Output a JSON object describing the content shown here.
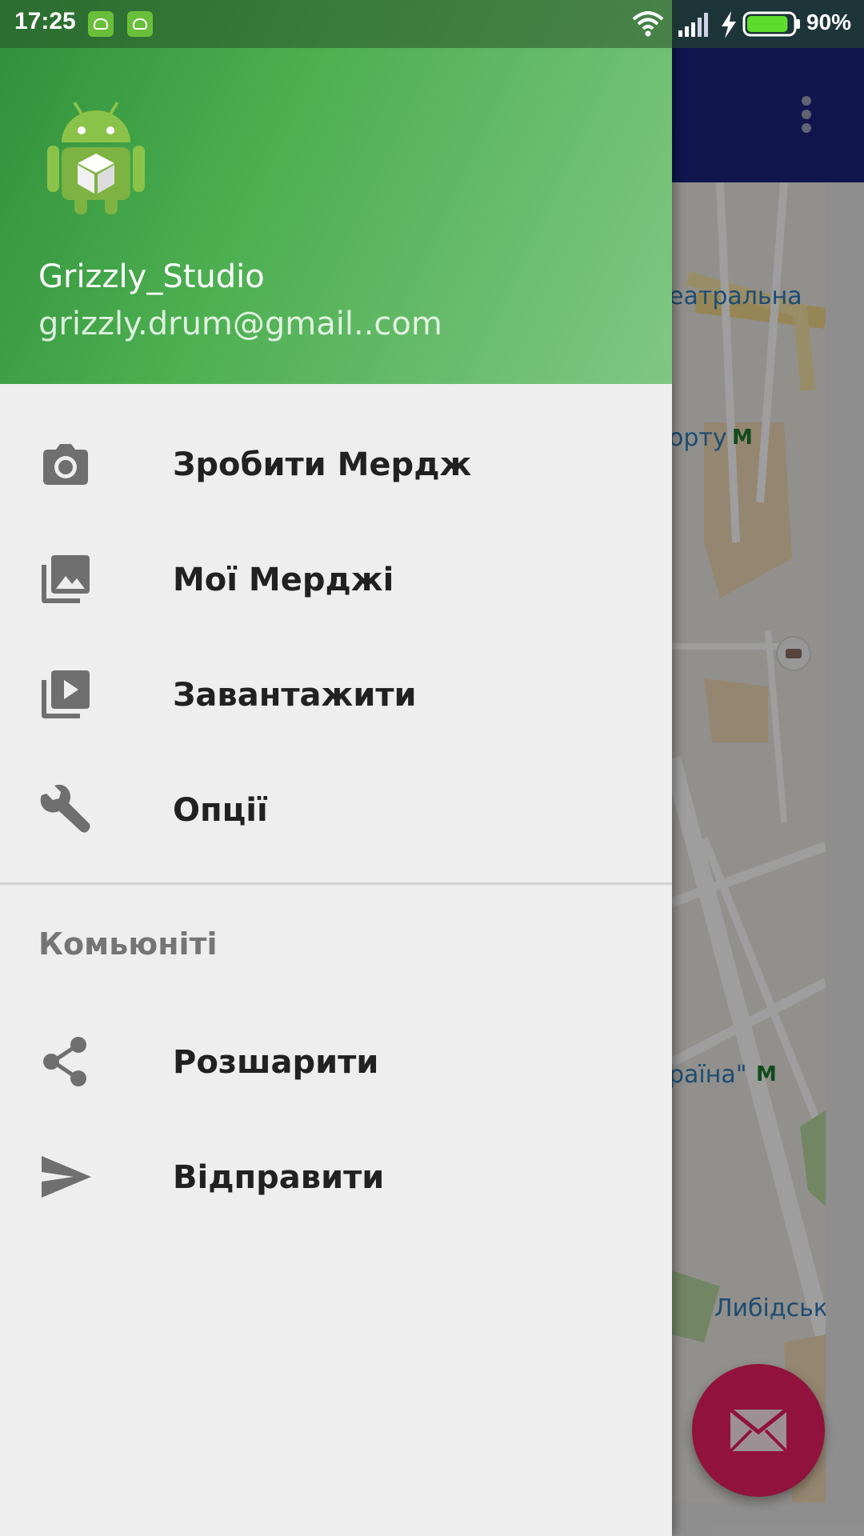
{
  "status_bar": {
    "time": "17:25",
    "battery_percent": "90%",
    "battery_level": 0.9,
    "icons": [
      "android-notification-icon",
      "android-notification-icon",
      "wifi-icon",
      "signal-icon",
      "charging-icon",
      "battery-icon"
    ]
  },
  "drawer": {
    "header": {
      "user_name": "Grizzly_Studio",
      "user_email": "grizzly.drum@gmail..com",
      "avatar_icon": "android-robot-cube-icon"
    },
    "items": [
      {
        "label": "Зробити Мердж",
        "icon": "camera-icon"
      },
      {
        "label": "Мої Мерджі",
        "icon": "photo-library-icon"
      },
      {
        "label": "Завантажити",
        "icon": "video-library-icon"
      },
      {
        "label": "Опції",
        "icon": "wrench-icon"
      }
    ],
    "section_title": "Комьюніті",
    "community_items": [
      {
        "label": "Розшарити",
        "icon": "share-icon"
      },
      {
        "label": "Відправити",
        "icon": "send-icon"
      }
    ]
  },
  "background": {
    "toolbar_color": "#1a237e",
    "fab_icon": "mail-icon",
    "fab_color": "#e91e63",
    "map_labels": [
      "еатральна",
      "орту",
      "раїна\"",
      "Либідськ"
    ],
    "metro_symbol": "M"
  },
  "colors": {
    "header_gradient_start": "#2f8f3a",
    "header_gradient_end": "#81c784",
    "drawer_background": "#eeeeee"
  }
}
